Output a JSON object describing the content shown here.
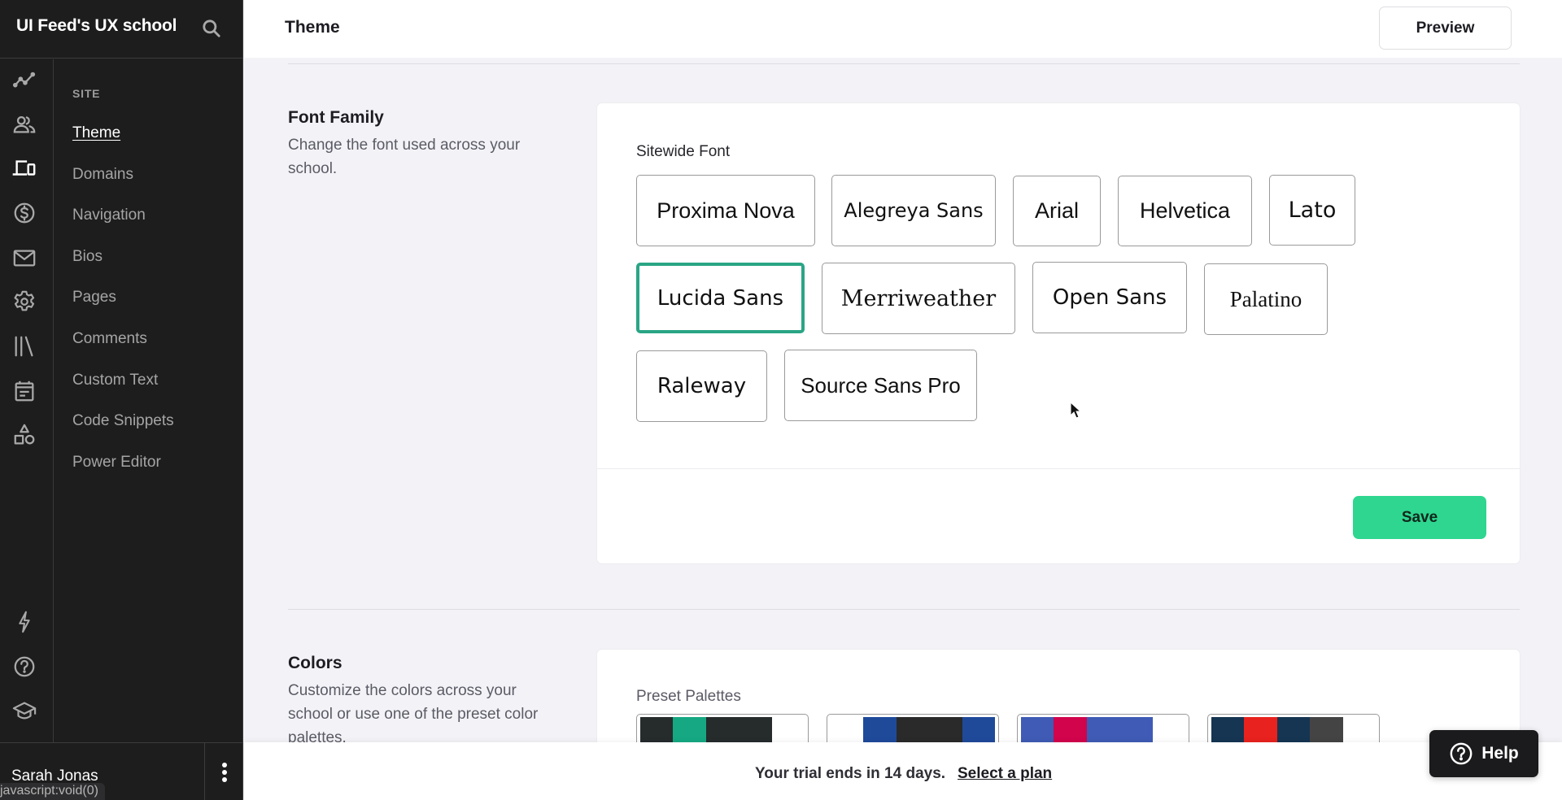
{
  "brand": {
    "title": "UI Feed's UX school",
    "search_icon": "search-icon"
  },
  "rail": [
    {
      "name": "analytics",
      "icon": "trend-line-icon",
      "active": false
    },
    {
      "name": "users",
      "icon": "users-icon",
      "active": false
    },
    {
      "name": "site",
      "icon": "devices-icon",
      "active": true
    },
    {
      "name": "sales",
      "icon": "dollar-circle-icon",
      "active": false
    },
    {
      "name": "emails",
      "icon": "mail-icon",
      "active": false
    },
    {
      "name": "settings",
      "icon": "gear-icon",
      "active": false
    },
    {
      "name": "library",
      "icon": "library-icon",
      "active": false
    },
    {
      "name": "calendar",
      "icon": "calendar-icon",
      "active": false
    },
    {
      "name": "apps",
      "icon": "shapes-icon",
      "active": false
    }
  ],
  "rail_bottom": [
    {
      "name": "whats-new",
      "icon": "lightning-icon"
    },
    {
      "name": "help",
      "icon": "question-circle-icon"
    },
    {
      "name": "school",
      "icon": "graduation-cap-icon"
    }
  ],
  "subnav": {
    "heading": "SITE",
    "items": [
      {
        "label": "Theme",
        "active": true
      },
      {
        "label": "Domains",
        "active": false
      },
      {
        "label": "Navigation",
        "active": false
      },
      {
        "label": "Bios",
        "active": false
      },
      {
        "label": "Pages",
        "active": false
      },
      {
        "label": "Comments",
        "active": false
      },
      {
        "label": "Custom Text",
        "active": false
      },
      {
        "label": "Code Snippets",
        "active": false
      },
      {
        "label": "Power Editor",
        "active": false
      }
    ]
  },
  "user": {
    "name": "Sarah Jonas",
    "menu_icon": "kebab-menu-icon"
  },
  "status_url": "javascript:void(0)",
  "header": {
    "title": "Theme",
    "preview_label": "Preview"
  },
  "font_section": {
    "title": "Font Family",
    "description": "Change the font used across your school.",
    "field_label": "Sitewide Font",
    "selected": "Lucida Sans",
    "options": [
      "Proxima Nova",
      "Alegreya Sans",
      "Arial",
      "Helvetica",
      "Lato",
      "Lucida Sans",
      "Merriweather",
      "Open Sans",
      "Palatino",
      "Raleway",
      "Source Sans Pro"
    ],
    "save_label": "Save"
  },
  "colors_section": {
    "title": "Colors",
    "description": "Customize the colors across your school or use one of the preset color palettes.",
    "field_label": "Preset Palettes",
    "palettes": [
      {
        "swatches": [
          "#262b2c",
          "#15a882",
          "#262b2c",
          "#262b2c",
          "#ffffff"
        ]
      },
      {
        "swatches": [
          "#ffffff",
          "#1f4a9a",
          "#2a2a2a",
          "#2a2a2a",
          "#1f4a9a"
        ]
      },
      {
        "swatches": [
          "#3f5bb5",
          "#d1044c",
          "#3f5bb5",
          "#3f5bb5",
          "#ffffff"
        ]
      },
      {
        "swatches": [
          "#153552",
          "#e8221e",
          "#153552",
          "#444444",
          "#ffffff"
        ]
      }
    ]
  },
  "trial": {
    "text": "Your trial ends in 14 days.",
    "link": "Select a plan"
  },
  "help": {
    "label": "Help"
  },
  "colors": {
    "accent": "#2ed68f",
    "selected_border": "#2aa585",
    "sidebar_bg": "#1d1d1d"
  }
}
